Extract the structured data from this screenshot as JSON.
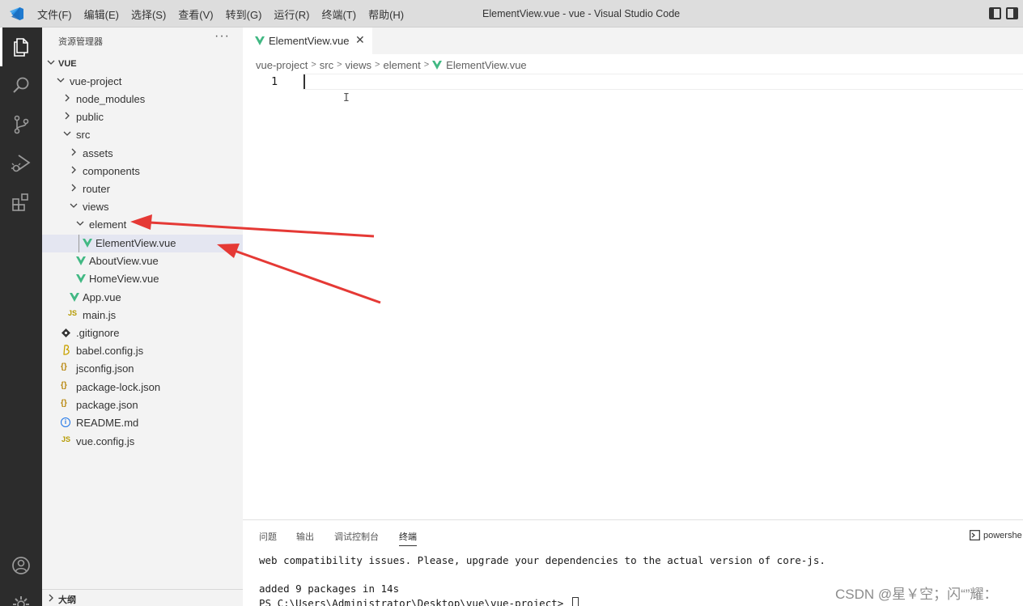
{
  "window": {
    "title": "ElementView.vue - vue - Visual Studio Code",
    "menu": [
      "文件(F)",
      "编辑(E)",
      "选择(S)",
      "查看(V)",
      "转到(G)",
      "运行(R)",
      "终端(T)",
      "帮助(H)"
    ]
  },
  "activity_bar": {
    "items": [
      "files-icon",
      "search-icon",
      "source-control-icon",
      "run-debug-icon",
      "extensions-icon"
    ],
    "bottom": [
      "account-icon",
      "settings-gear-icon"
    ]
  },
  "sidebar": {
    "title": "资源管理器",
    "more": "···",
    "root": "VUE",
    "tree": {
      "vue_project": "vue-project",
      "node_modules": "node_modules",
      "public": "public",
      "src": "src",
      "assets": "assets",
      "components": "components",
      "router": "router",
      "views": "views",
      "element": "element",
      "element_view": "ElementView.vue",
      "about_view": "AboutView.vue",
      "home_view": "HomeView.vue",
      "app_vue": "App.vue",
      "main_js": "main.js",
      "gitignore": ".gitignore",
      "babel_config": "babel.config.js",
      "jsconfig": "jsconfig.json",
      "package_lock": "package-lock.json",
      "package_json": "package.json",
      "readme": "README.md",
      "vue_config": "vue.config.js"
    },
    "icon_labels": {
      "js": "JS",
      "json": "{}",
      "info": "i"
    },
    "outline": "大纲"
  },
  "editor": {
    "tab_label": "ElementView.vue",
    "tab_close": "✕",
    "breadcrumbs": [
      "vue-project",
      "src",
      "views",
      "element",
      "ElementView.vue"
    ],
    "line_number": "1"
  },
  "panel": {
    "tabs": [
      "问题",
      "输出",
      "调试控制台",
      "终端"
    ],
    "active_tab": "终端",
    "terminal_select": "powershe",
    "terminal_lines": [
      " web compatibility issues. Please, upgrade your dependencies to the actual version of core-js.",
      "added 9 packages in 14s",
      "PS C:\\Users\\Administrator\\Desktop\\vue\\vue-project> "
    ]
  },
  "watermark": "CSDN @星￥空；闪“”耀：",
  "colors": {
    "activity_bar": "#2c2c2c",
    "sidebar": "#f3f3f3",
    "selection": "#e4e6f1",
    "vue_green": "#41b883",
    "js_yellow": "#b59a00",
    "json_yellow": "#b8860b",
    "info_blue": "#1a73e8",
    "arrow_red": "#e53935"
  }
}
